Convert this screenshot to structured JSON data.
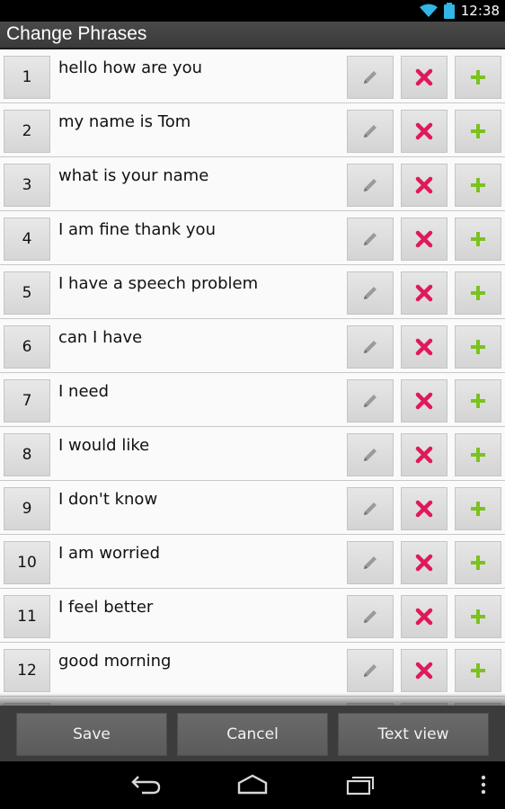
{
  "status_bar": {
    "time": "12:38"
  },
  "header": {
    "title": "Change Phrases"
  },
  "phrases": [
    {
      "number": "1",
      "text": "hello how are you"
    },
    {
      "number": "2",
      "text": "my name is Tom"
    },
    {
      "number": "3",
      "text": "what is your name"
    },
    {
      "number": "4",
      "text": "I am fine thank you"
    },
    {
      "number": "5",
      "text": "I have a speech problem"
    },
    {
      "number": "6",
      "text": "can I have"
    },
    {
      "number": "7",
      "text": "I need"
    },
    {
      "number": "8",
      "text": "I would like"
    },
    {
      "number": "9",
      "text": "I don't know"
    },
    {
      "number": "10",
      "text": "I am worried"
    },
    {
      "number": "11",
      "text": "I feel better"
    },
    {
      "number": "12",
      "text": "good morning"
    }
  ],
  "icons": {
    "edit": "pencil-icon",
    "delete": "x-icon",
    "add": "plus-icon"
  },
  "colors": {
    "delete": "#e0195a",
    "add": "#7cc21e",
    "title_bar": "#404040",
    "button_bar": "#3c3c3c"
  },
  "buttons": {
    "save": "Save",
    "cancel": "Cancel",
    "text_view": "Text view"
  }
}
